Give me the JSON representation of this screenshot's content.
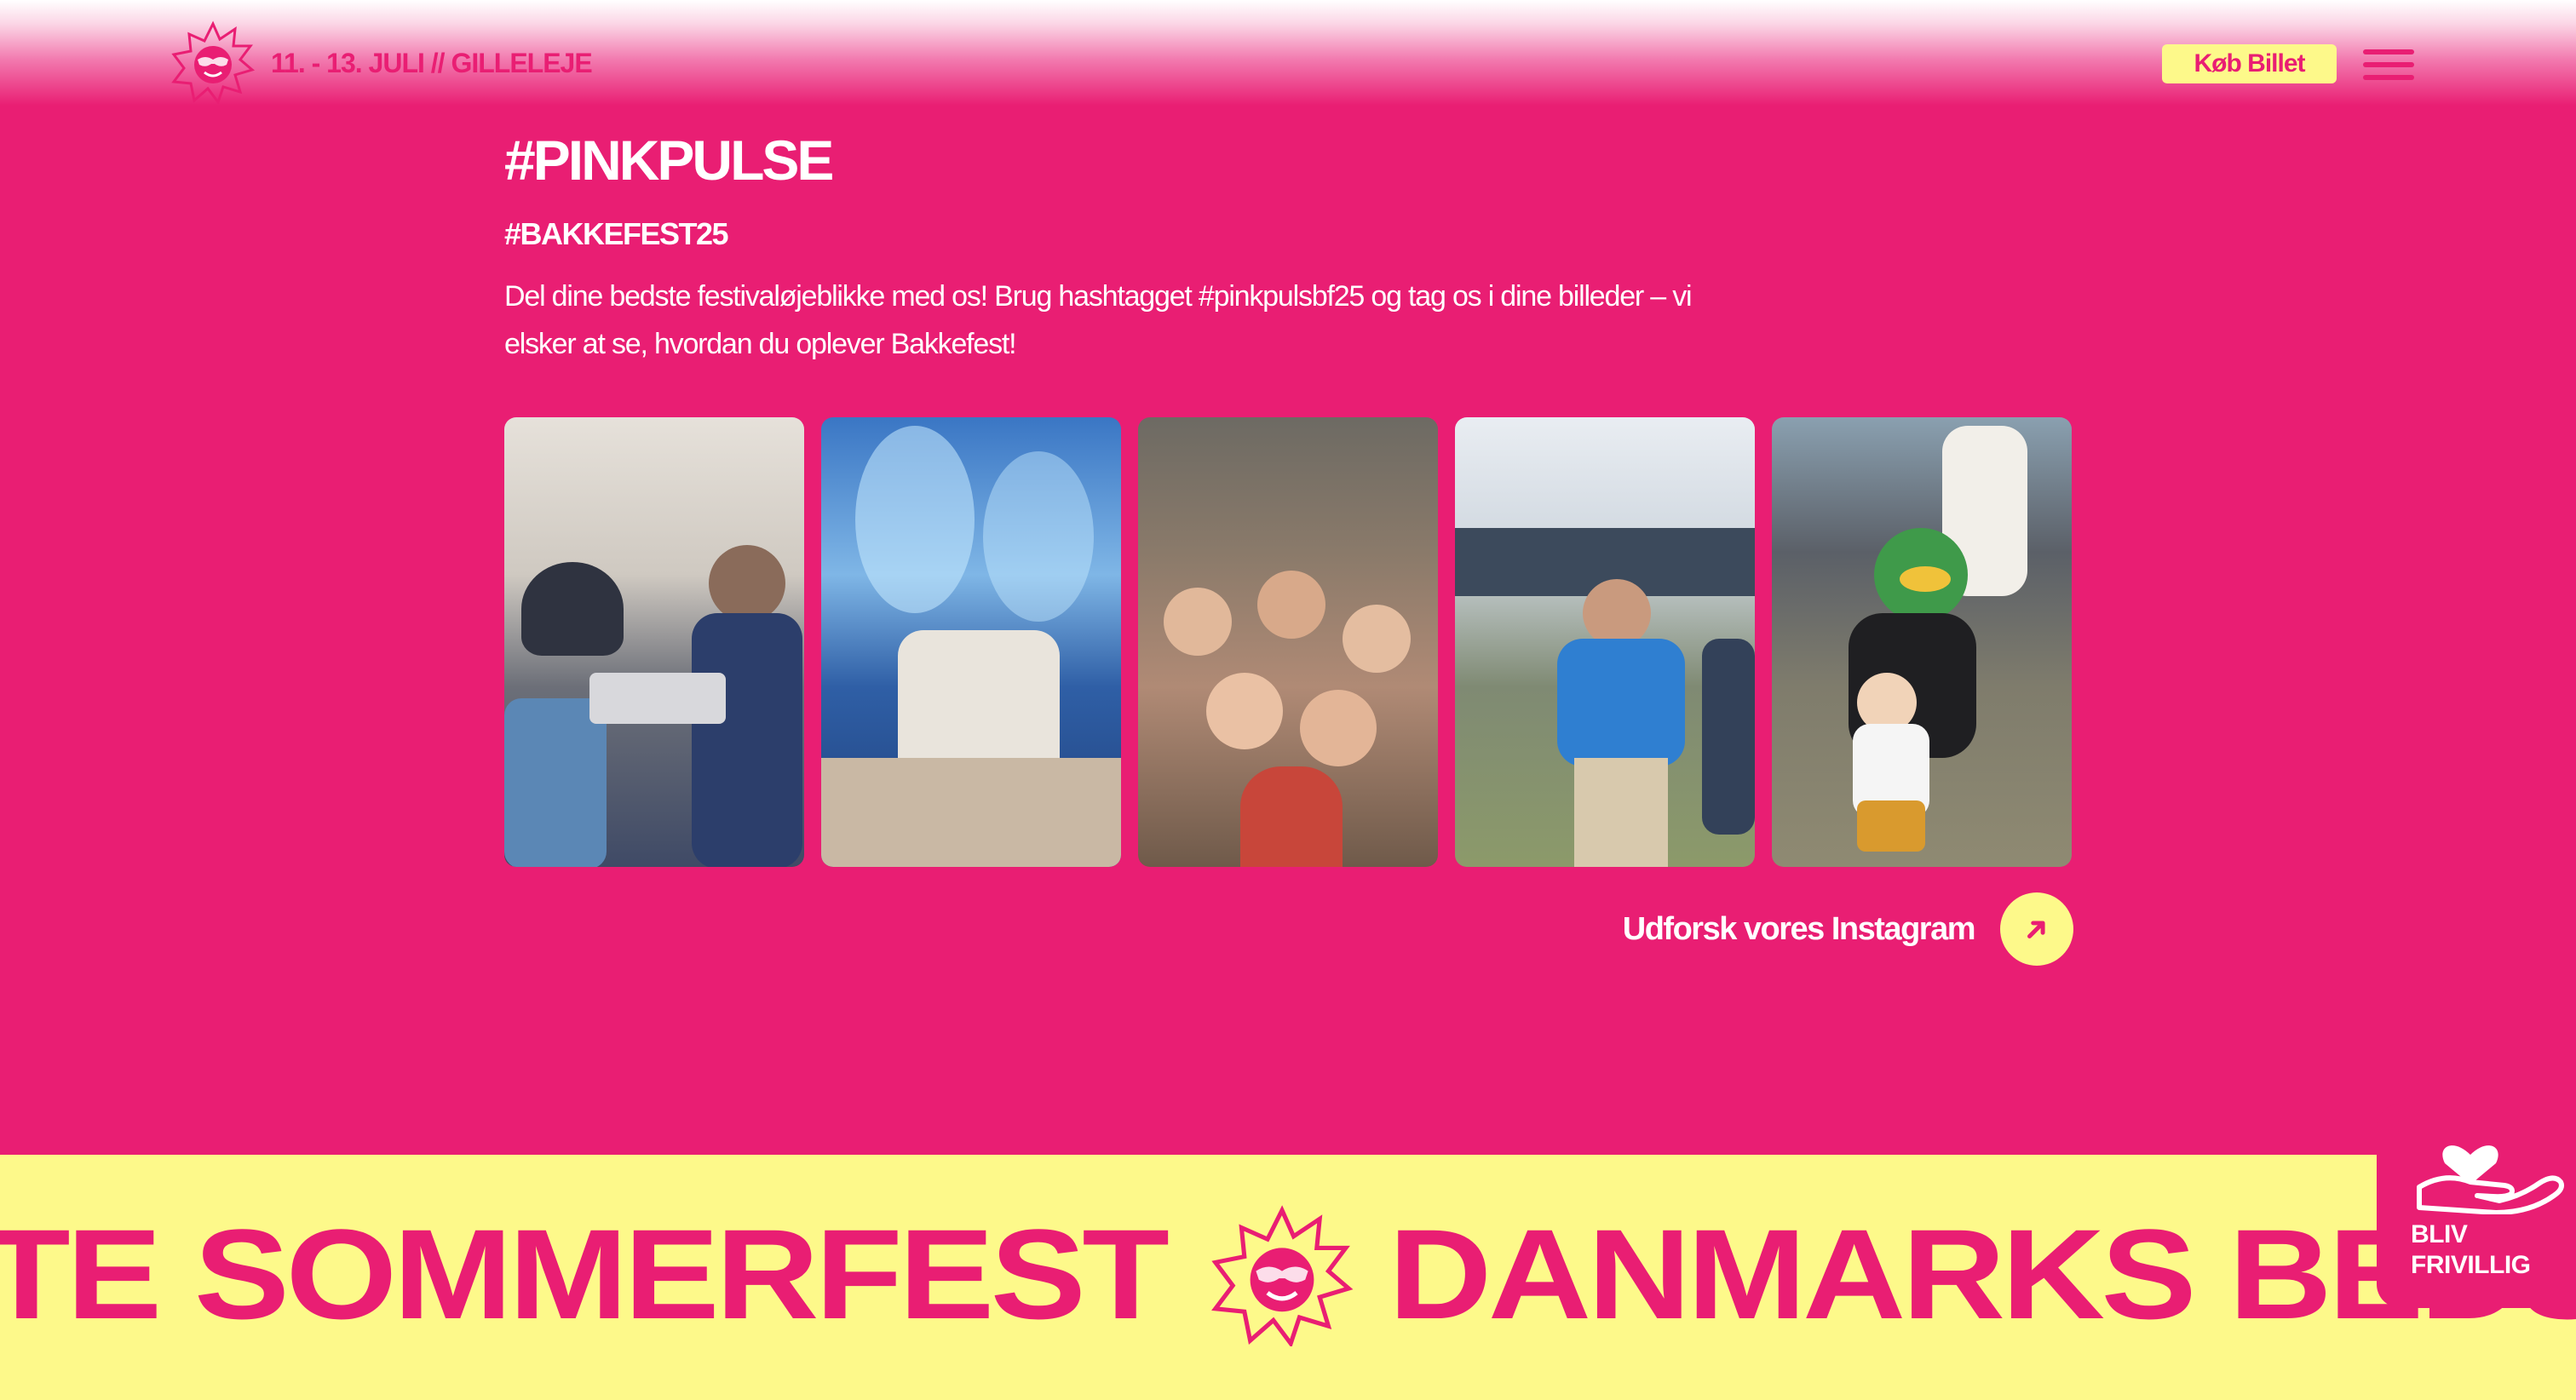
{
  "header": {
    "date_location": "11. - 13. JULI // GILLELEJE",
    "buy_ticket_label": "Køb Billet",
    "logo_icon": "sun-logo-icon",
    "menu_icon": "hamburger-menu-icon"
  },
  "main": {
    "title": "#PINKPULSE",
    "subtitle": "#BAKKEFEST25",
    "description": "Del dine bedste festivaløjeblikke med os! Brug hashtagget #pinkpulsbf25 og tag os i dine billeder – vi elsker at se, hvordan du oplever Bakkefest!",
    "gallery": [
      {
        "icon": "photo-buffet"
      },
      {
        "icon": "photo-concert-stage"
      },
      {
        "icon": "photo-crowd"
      },
      {
        "icon": "photo-tent-dancing"
      },
      {
        "icon": "photo-mascot-child"
      }
    ],
    "instagram_link_label": "Udforsk vores Instagram",
    "instagram_arrow_icon": "arrow-up-right-icon"
  },
  "marquee": {
    "text_1": "TE SOMMERFEST",
    "text_2": "DANMARKS BEDSTE"
  },
  "volunteer": {
    "line_1": "BLIV",
    "line_2": "FRIVILLIG",
    "icon": "heart-hand-icon"
  },
  "colors": {
    "pink": "#e91e73",
    "yellow": "#fdf98a",
    "white": "#ffffff"
  }
}
